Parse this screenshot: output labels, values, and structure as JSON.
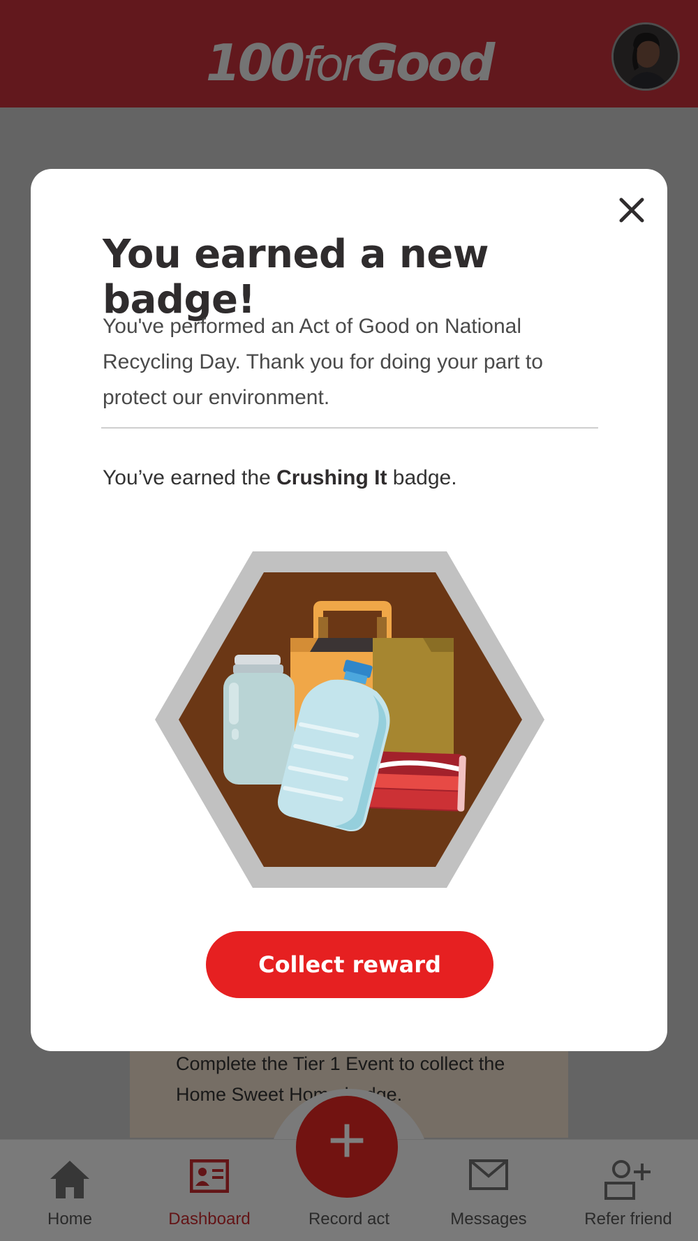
{
  "header": {
    "logo_num": "100",
    "logo_for": "for",
    "logo_good": "Good"
  },
  "event_card": {
    "text": "Complete the Tier 1 Event to collect the Home Sweet Home badge."
  },
  "bottom_nav": {
    "items": [
      {
        "label": "Home",
        "icon": "home-icon"
      },
      {
        "label": "Dashboard",
        "icon": "dashboard-icon",
        "active": true
      },
      {
        "label": "Record act",
        "icon": "plus-icon"
      },
      {
        "label": "Messages",
        "icon": "envelope-icon"
      },
      {
        "label": "Refer friend",
        "icon": "add-user-icon"
      }
    ],
    "fab_symbol": "+"
  },
  "modal": {
    "title": "You earned a new badge!",
    "description": "You've performed an Act of Good on National Recycling Day. Thank you for doing your part to protect our environment.",
    "earned_prefix": "You’ve earned the ",
    "badge_name": "Crushing It",
    "earned_suffix": " badge.",
    "collect_button": "Collect reward",
    "close_icon": "close-icon"
  },
  "colors": {
    "brand_red": "#e62021",
    "header_red": "#c4303a",
    "badge_brown": "#6b3715",
    "badge_frame": "#c1c1c1"
  }
}
